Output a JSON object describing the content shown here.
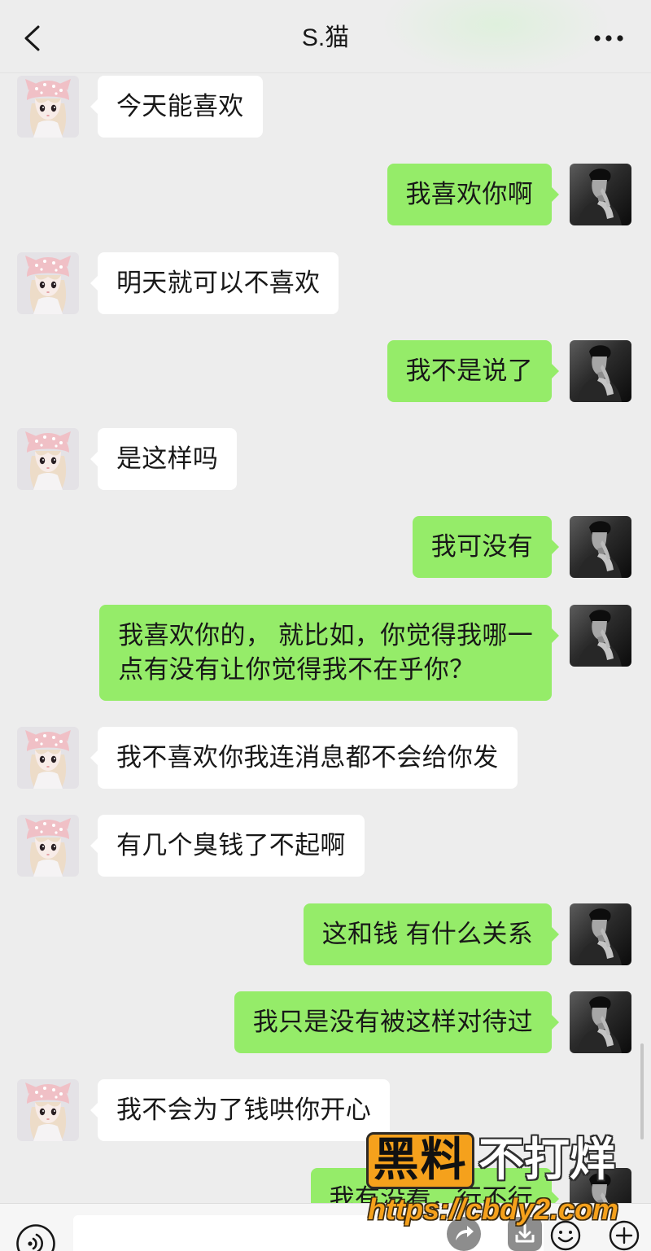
{
  "header": {
    "title": "S.猫",
    "back_icon": "chevron-left-icon",
    "more_icon": "more-dots-icon"
  },
  "colors": {
    "background": "#ededed",
    "self_bubble": "#95ec69",
    "other_bubble": "#ffffff",
    "text": "#181818",
    "watermark_orange": "#f5a11c"
  },
  "avatars": {
    "other": "girl-doll-avatar",
    "self": "man-portrait-avatar"
  },
  "messages": [
    {
      "outgoing": false,
      "text": "今天能喜欢"
    },
    {
      "outgoing": true,
      "text": "我喜欢你啊"
    },
    {
      "outgoing": false,
      "text": "明天就可以不喜欢"
    },
    {
      "outgoing": true,
      "text": "我不是说了"
    },
    {
      "outgoing": false,
      "text": "是这样吗"
    },
    {
      "outgoing": true,
      "text": "我可没有"
    },
    {
      "outgoing": true,
      "text": "我喜欢你的， 就比如，你觉得我哪一\n点有没有让你觉得我不在乎你？"
    },
    {
      "outgoing": false,
      "text": "我不喜欢你我连消息都不会给你发"
    },
    {
      "outgoing": false,
      "text": "有几个臭钱了不起啊"
    },
    {
      "outgoing": true,
      "text": "这和钱 有什么关系"
    },
    {
      "outgoing": true,
      "text": "我只是没有被这样对待过"
    },
    {
      "outgoing": false,
      "text": "我不会为了钱哄你开心"
    },
    {
      "outgoing": true,
      "text": "我有没看，行不行"
    }
  ],
  "input_bar": {
    "voice_icon": "voice-icon",
    "share_icon": "share-icon",
    "download_icon": "download-icon",
    "emoji_icon": "emoji-icon",
    "plus_icon": "plus-icon"
  },
  "watermark": {
    "badge": "黑料",
    "tagline": "不打烊",
    "url": "https://cbdy2.com"
  }
}
